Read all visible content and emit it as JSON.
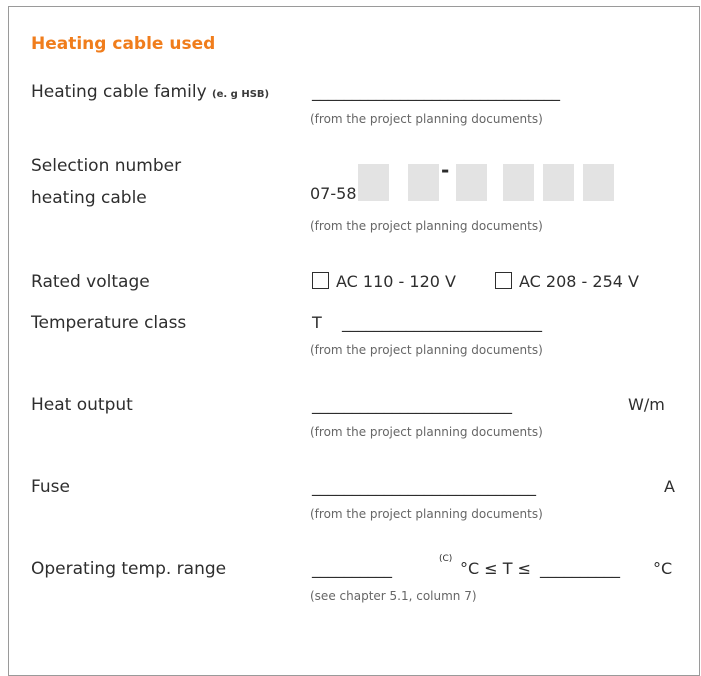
{
  "heading": "Heating cable used",
  "family": {
    "label": "Heating cable family",
    "hint": "(e. g HSB)",
    "blank": "_______________________________",
    "note": "(from the project planning documents)"
  },
  "selection": {
    "label_line1": "Selection number",
    "label_line2": "heating cable",
    "prefix": "07-58",
    "dash": "-",
    "note": "(from the project planning documents)"
  },
  "voltage": {
    "label": "Rated voltage",
    "options": [
      "AC 110 - 120 V",
      "AC 208 - 254 V"
    ]
  },
  "temp_class": {
    "label": "Temperature class",
    "prefix": "T",
    "blank": "_________________________",
    "note": "(from the project planning documents)"
  },
  "heat_output": {
    "label": "Heat output",
    "blank": "_________________________",
    "unit": "W/m",
    "note": "(from the project planning documents)"
  },
  "fuse": {
    "label": "Fuse",
    "blank": "____________________________",
    "unit": "A",
    "note": "(from the project planning documents)"
  },
  "op_range": {
    "label": "Operating temp. range",
    "blank1": "__________",
    "sup": "(C)",
    "mid": "°C ≤ T ≤",
    "blank2": "__________",
    "unit": "°C",
    "note": "(see chapter 5.1, column 7)"
  }
}
